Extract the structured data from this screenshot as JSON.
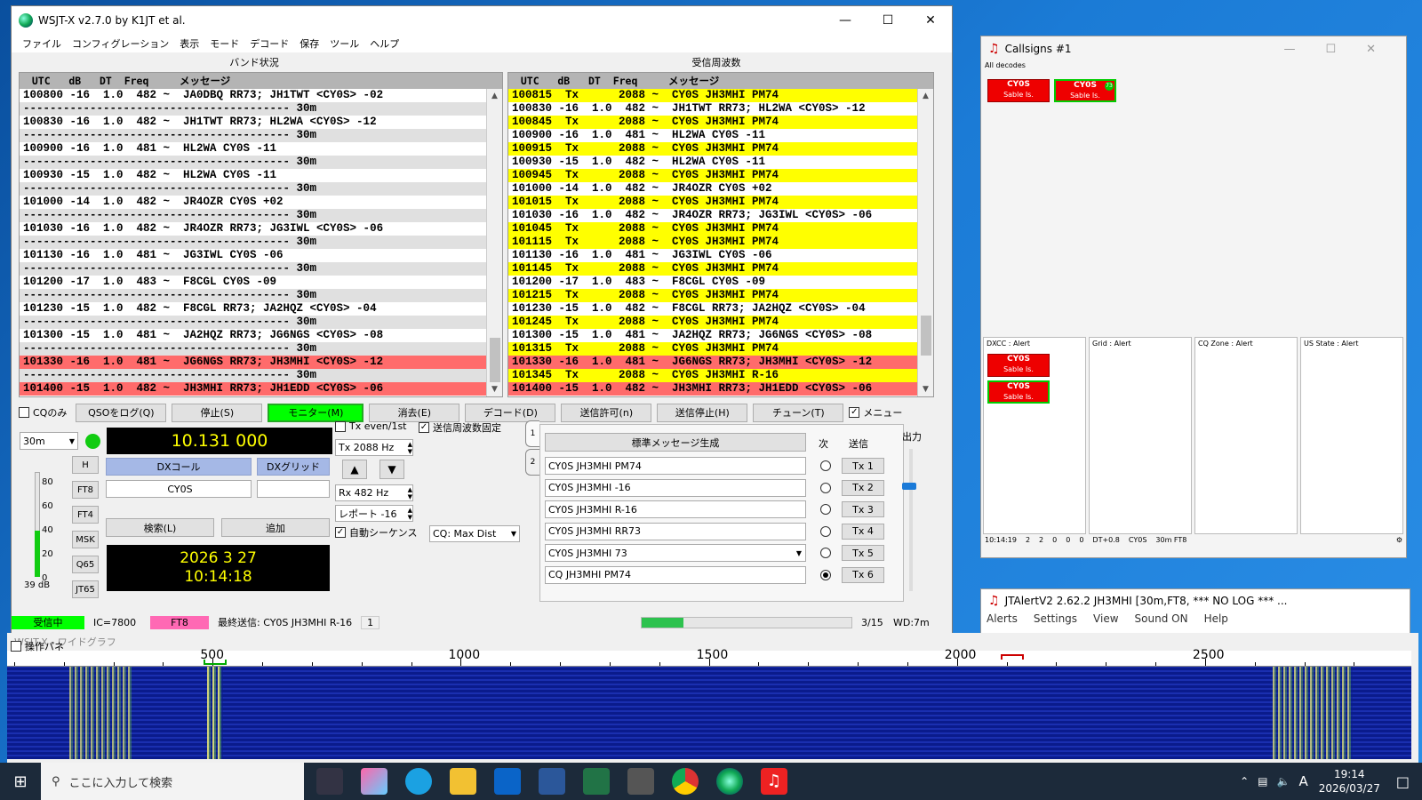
{
  "main": {
    "title": "WSJT-X   v2.7.0   by K1JT et al.",
    "menu": [
      "ファイル",
      "コンフィグレーション",
      "表示",
      "モード",
      "デコード",
      "保存",
      "ツール",
      "ヘルプ"
    ],
    "band_title": "バンド状況",
    "rx_title": "受信周波数",
    "header_left": "  UTC   dB   DT  Freq     メッセージ",
    "header_right": "  UTC   dB   DT  Freq     メッセージ",
    "band_rows": [
      {
        "t": "100800 -16  1.0  482 ~  JA0DBQ RR73; JH1TWT <CY0S> -02",
        "k": ""
      },
      {
        "t": "---------------------------------------- 30m",
        "k": "sep"
      },
      {
        "t": "100830 -16  1.0  482 ~  JH1TWT RR73; HL2WA <CY0S> -12",
        "k": ""
      },
      {
        "t": "---------------------------------------- 30m",
        "k": "sep"
      },
      {
        "t": "100900 -16  1.0  481 ~  HL2WA CY0S -11",
        "k": ""
      },
      {
        "t": "---------------------------------------- 30m",
        "k": "sep"
      },
      {
        "t": "100930 -15  1.0  482 ~  HL2WA CY0S -11",
        "k": ""
      },
      {
        "t": "---------------------------------------- 30m",
        "k": "sep"
      },
      {
        "t": "101000 -14  1.0  482 ~  JR4OZR CY0S +02",
        "k": ""
      },
      {
        "t": "---------------------------------------- 30m",
        "k": "sep"
      },
      {
        "t": "101030 -16  1.0  482 ~  JR4OZR RR73; JG3IWL <CY0S> -06",
        "k": ""
      },
      {
        "t": "---------------------------------------- 30m",
        "k": "sep"
      },
      {
        "t": "101130 -16  1.0  481 ~  JG3IWL CY0S -06",
        "k": ""
      },
      {
        "t": "---------------------------------------- 30m",
        "k": "sep"
      },
      {
        "t": "101200 -17  1.0  483 ~  F8CGL CY0S -09",
        "k": ""
      },
      {
        "t": "---------------------------------------- 30m",
        "k": "sep"
      },
      {
        "t": "101230 -15  1.0  482 ~  F8CGL RR73; JA2HQZ <CY0S> -04",
        "k": ""
      },
      {
        "t": "---------------------------------------- 30m",
        "k": "sep"
      },
      {
        "t": "101300 -15  1.0  481 ~  JA2HQZ RR73; JG6NGS <CY0S> -08",
        "k": ""
      },
      {
        "t": "---------------------------------------- 30m",
        "k": "sep"
      },
      {
        "t": "101330 -16  1.0  481 ~  JG6NGS RR73; JH3MHI <CY0S> -12",
        "k": "red"
      },
      {
        "t": "---------------------------------------- 30m",
        "k": "sep"
      },
      {
        "t": "101400 -15  1.0  482 ~  JH3MHI RR73; JH1EDD <CY0S> -06",
        "k": "red"
      }
    ],
    "rx_rows": [
      {
        "t": "100815  Tx      2088 ~  CY0S JH3MHI PM74",
        "k": "tx"
      },
      {
        "t": "100830 -16  1.0  482 ~  JH1TWT RR73; HL2WA <CY0S> -12",
        "k": ""
      },
      {
        "t": "100845  Tx      2088 ~  CY0S JH3MHI PM74",
        "k": "tx"
      },
      {
        "t": "100900 -16  1.0  481 ~  HL2WA CY0S -11",
        "k": ""
      },
      {
        "t": "100915  Tx      2088 ~  CY0S JH3MHI PM74",
        "k": "tx"
      },
      {
        "t": "100930 -15  1.0  482 ~  HL2WA CY0S -11",
        "k": ""
      },
      {
        "t": "100945  Tx      2088 ~  CY0S JH3MHI PM74",
        "k": "tx"
      },
      {
        "t": "101000 -14  1.0  482 ~  JR4OZR CY0S +02",
        "k": ""
      },
      {
        "t": "101015  Tx      2088 ~  CY0S JH3MHI PM74",
        "k": "tx"
      },
      {
        "t": "101030 -16  1.0  482 ~  JR4OZR RR73; JG3IWL <CY0S> -06",
        "k": ""
      },
      {
        "t": "101045  Tx      2088 ~  CY0S JH3MHI PM74",
        "k": "tx"
      },
      {
        "t": "101115  Tx      2088 ~  CY0S JH3MHI PM74",
        "k": "tx"
      },
      {
        "t": "101130 -16  1.0  481 ~  JG3IWL CY0S -06",
        "k": ""
      },
      {
        "t": "101145  Tx      2088 ~  CY0S JH3MHI PM74",
        "k": "tx"
      },
      {
        "t": "101200 -17  1.0  483 ~  F8CGL CY0S -09",
        "k": ""
      },
      {
        "t": "101215  Tx      2088 ~  CY0S JH3MHI PM74",
        "k": "tx"
      },
      {
        "t": "101230 -15  1.0  482 ~  F8CGL RR73; JA2HQZ <CY0S> -04",
        "k": ""
      },
      {
        "t": "101245  Tx      2088 ~  CY0S JH3MHI PM74",
        "k": "tx"
      },
      {
        "t": "101300 -15  1.0  481 ~  JA2HQZ RR73; JG6NGS <CY0S> -08",
        "k": ""
      },
      {
        "t": "101315  Tx      2088 ~  CY0S JH3MHI PM74",
        "k": "tx"
      },
      {
        "t": "101330 -16  1.0  481 ~  JG6NGS RR73; JH3MHI <CY0S> -12",
        "k": "red"
      },
      {
        "t": "101345  Tx      2088 ~  CY0S JH3MHI R-16",
        "k": "tx"
      },
      {
        "t": "101400 -15  1.0  482 ~  JH3MHI RR73; JH1EDD <CY0S> -06",
        "k": "red"
      }
    ],
    "buttons": {
      "cq_only": "CQのみ",
      "log_qso": "QSOをログ(Q)",
      "stop": "停止(S)",
      "monitor": "モニター(M)",
      "erase": "消去(E)",
      "decode": "デコード(D)",
      "enable_tx": "送信許可(n)",
      "halt_tx": "送信停止(H)",
      "tune": "チューン(T)",
      "menu": "メニュー"
    },
    "band": "30m",
    "dial": "10.131 000",
    "mode_buttons": [
      "H",
      "FT8",
      "FT4",
      "MSK",
      "Q65",
      "JT65"
    ],
    "dx_call_label": "DXコール",
    "dx_grid_label": "DXグリッド",
    "dx_call": "CY0S",
    "dx_grid": "",
    "lookup": "検索(L)",
    "add": "追加",
    "date": "2026 3 27",
    "time": "10:14:18",
    "signal_db": "39 dB",
    "meter_ticks": [
      "80",
      "60",
      "40",
      "20",
      "0"
    ],
    "tx_even": "Tx even/1st",
    "hold_tx": "送信周波数固定",
    "tx_freq": "Tx  2088  Hz",
    "rx_freq": "Rx  482  Hz",
    "report": "レポート  -16",
    "auto_seq": "自動シーケンス",
    "cq_dist": "CQ: Max Dist",
    "gen_msgs": "標準メッセージ生成",
    "next_label": "次",
    "send_label": "送信",
    "power_label": "出力",
    "tab1": "1",
    "tab2": "2",
    "messages": [
      {
        "text": "CY0S JH3MHI PM74",
        "btn": "Tx 1"
      },
      {
        "text": "CY0S JH3MHI -16",
        "btn": "Tx 2"
      },
      {
        "text": "CY0S JH3MHI R-16",
        "btn": "Tx 3"
      },
      {
        "text": "CY0S JH3MHI RR73",
        "btn": "Tx 4"
      },
      {
        "text": "CY0S JH3MHI 73",
        "btn": "Tx 5"
      },
      {
        "text": "CQ JH3MHI PM74",
        "btn": "Tx 6"
      }
    ],
    "status": {
      "rx": "受信中",
      "ic": "IC=7800",
      "mode": "FT8",
      "last_tx": "最終送信: CY0S JH3MHI R-16",
      "count": "1",
      "period": "3/15",
      "wd": "WD:7m"
    },
    "progress": 0.2
  },
  "callsigns": {
    "title": "Callsigns #1",
    "all_decodes": "All decodes",
    "tile_call": "CY0S",
    "tile_sub": "Sable Is.",
    "tile_badge": "73",
    "alerts": [
      "DXCC : Alert",
      "Grid : Alert",
      "CQ Zone : Alert",
      "US State : Alert"
    ],
    "status": [
      "10:14:19",
      "2",
      "2",
      "0",
      "0",
      "0",
      "DT+0.8",
      "CY0S",
      "30m FT8"
    ]
  },
  "jtalert": {
    "title": "JTAlertV2  2.62.2 JH3MHI [30m,FT8,   *** NO LOG ***  ...",
    "menu": [
      "Alerts",
      "Settings",
      "View",
      "Sound ON",
      "Help"
    ]
  },
  "waterfall": {
    "title": "WSJT-X - ワイドグラフ",
    "control": "操作パネ",
    "ticks": [
      "500",
      "1000",
      "1500",
      "2000",
      "2500"
    ]
  },
  "taskbar": {
    "search": "ここに入力して検索",
    "time": "19:14",
    "date": "2026/03/27",
    "ime": "A"
  }
}
